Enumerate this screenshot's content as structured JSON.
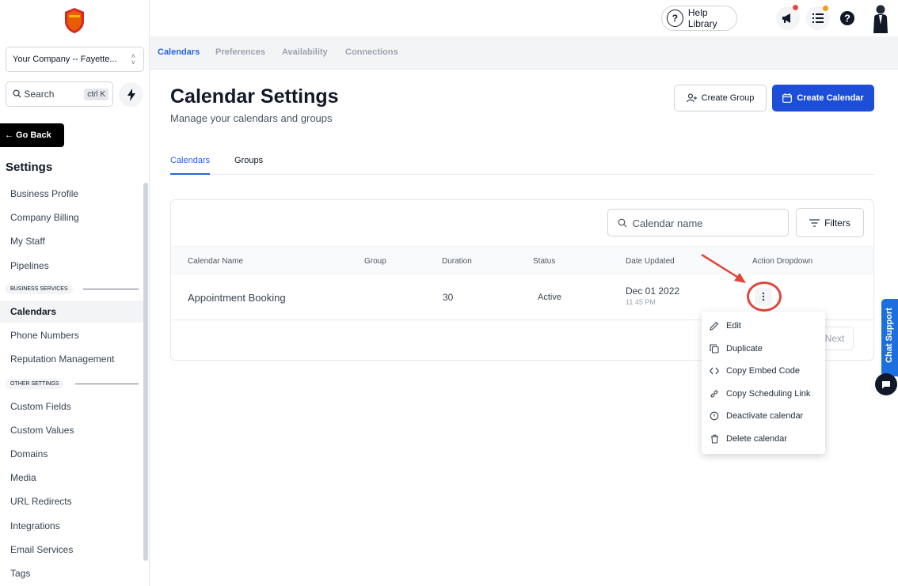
{
  "sidebar": {
    "company": "Your Company -- Fayette...",
    "search_label": "Search",
    "search_shortcut": "ctrl K",
    "go_back": "← Go Back",
    "settings_title": "Settings",
    "items": [
      {
        "label": "Business Profile"
      },
      {
        "label": "Company Billing"
      },
      {
        "label": "My Staff"
      },
      {
        "label": "Pipelines"
      },
      {
        "label": "Calendars"
      },
      {
        "label": "Phone Numbers"
      },
      {
        "label": "Reputation Management"
      },
      {
        "label": "Custom Fields"
      },
      {
        "label": "Custom Values"
      },
      {
        "label": "Domains"
      },
      {
        "label": "Media"
      },
      {
        "label": "URL Redirects"
      },
      {
        "label": "Integrations"
      },
      {
        "label": "Email Services"
      },
      {
        "label": "Tags"
      }
    ],
    "sections": {
      "business_services": "BUSINESS SERVICES",
      "other_settings": "OTHER SETTINGS"
    }
  },
  "header": {
    "help_label": "Help Library",
    "help_icon": "?"
  },
  "subtabs": [
    "Calendars",
    "Preferences",
    "Availability",
    "Connections"
  ],
  "main": {
    "title": "Calendar Settings",
    "subtitle": "Manage your calendars and groups",
    "create_group": "Create Group",
    "create_calendar": "Create Calendar",
    "tabs": [
      "Calendars",
      "Groups"
    ],
    "search_placeholder": "Calendar name",
    "filters": "Filters",
    "columns": [
      "Calendar Name",
      "Group",
      "Duration",
      "Status",
      "Date Updated",
      "Action Dropdown"
    ],
    "row": {
      "name": "Appointment Booking",
      "group": "",
      "duration": "30",
      "status": "Active",
      "date": "Dec 01 2022",
      "time": "11 45 PM"
    },
    "next": "Next"
  },
  "dropdown": {
    "items": [
      {
        "label": "Edit",
        "icon": "pencil-icon"
      },
      {
        "label": "Duplicate",
        "icon": "copy-icon"
      },
      {
        "label": "Copy Embed Code",
        "icon": "code-icon"
      },
      {
        "label": "Copy Scheduling Link",
        "icon": "link-icon"
      },
      {
        "label": "Deactivate calendar",
        "icon": "clock-icon"
      },
      {
        "label": "Delete calendar",
        "icon": "trash-icon"
      }
    ]
  },
  "chat_support": "Chat Support",
  "colors": {
    "primary": "#1d4ed8",
    "accent_red": "#e0453a",
    "chat_blue": "#1d6fe0"
  }
}
